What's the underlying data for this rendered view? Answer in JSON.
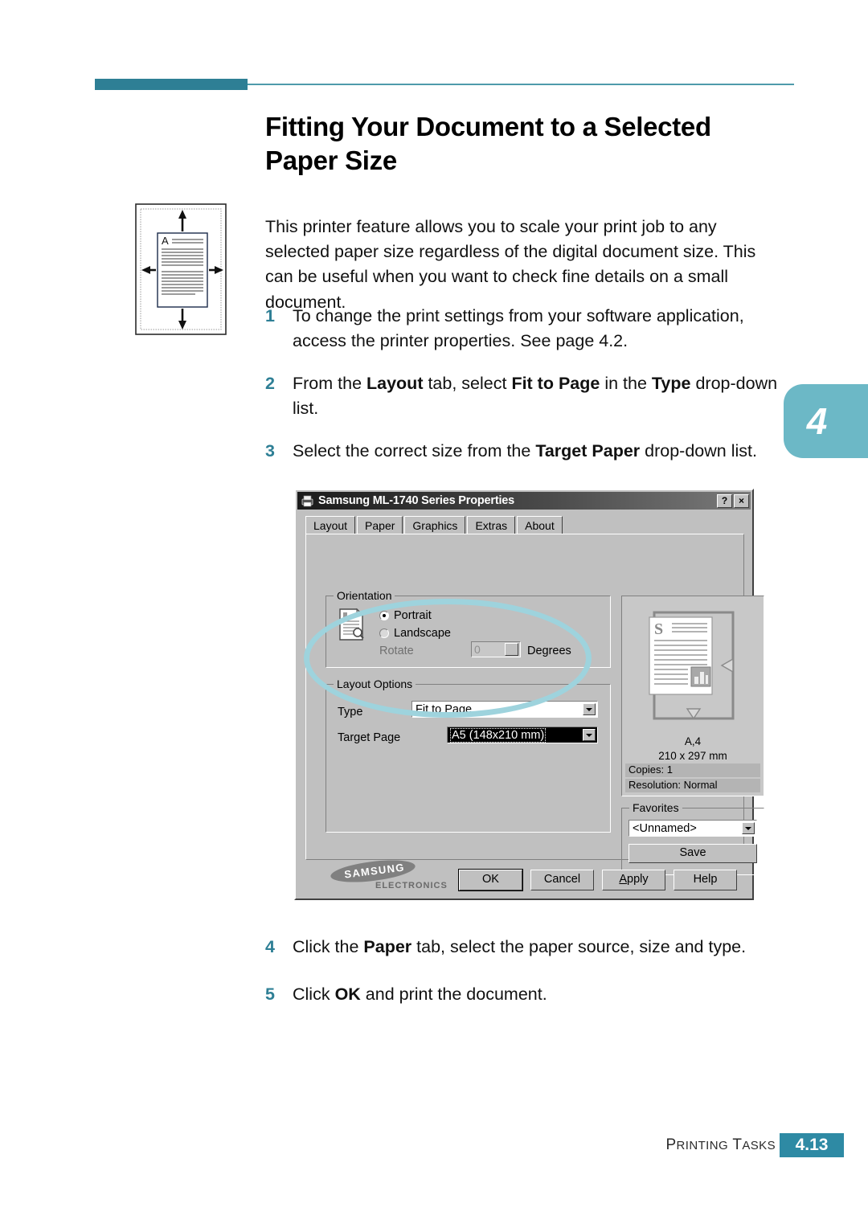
{
  "page": {
    "title_line1": "Fitting Your Document to a Selected",
    "title_line2": "Paper Size",
    "chapter_tab": "4",
    "accent_dark": "#2e7f95",
    "accent_light": "#6cb8c6",
    "highlight_color": "#9ed3dd"
  },
  "intro": {
    "text": "This printer feature allows you to scale your print job to any selected paper size regardless of the digital document size. This can be useful when you want to check fine details on a small document.",
    "illustration_letter": "A"
  },
  "steps": [
    {
      "num": "1",
      "html": "To change the print settings from your software application, access the printer properties. See page 4.2."
    },
    {
      "num": "2",
      "html": "From the <b>Layout</b> tab, select <b>Fit to Page</b> in the <b>Type</b> drop-down list."
    },
    {
      "num": "3",
      "html": "Select the correct size from the <b>Target Paper</b> drop-down list."
    },
    {
      "num": "4",
      "html": "Click the <b>Paper</b> tab, select the paper source, size and type."
    },
    {
      "num": "5",
      "html": "Click <b>OK</b> and print the document."
    }
  ],
  "dialog": {
    "title": "Samsung ML-1740 Series Properties",
    "titlebar_help": "?",
    "titlebar_close": "×",
    "tabs": [
      {
        "label": "Layout",
        "active": true
      },
      {
        "label": "Paper",
        "active": false
      },
      {
        "label": "Graphics",
        "active": false
      },
      {
        "label": "Extras",
        "active": false
      },
      {
        "label": "About",
        "active": false
      }
    ],
    "orientation": {
      "group_title": "Orientation",
      "portrait_label": "Portrait",
      "landscape_label": "Landscape",
      "portrait_selected": true,
      "rotate_label": "Rotate",
      "rotate_value": "0",
      "degrees_label": "Degrees"
    },
    "layout_options": {
      "group_title": "Layout Options",
      "type_label": "Type",
      "type_value": "Fit to Page",
      "target_label": "Target Page",
      "target_value": "A5 (148x210 mm)"
    },
    "preview": {
      "page_letter": "S",
      "paper_name": "A,4",
      "paper_dims": "210 x 297 mm",
      "copies": "Copies: 1",
      "resolution": "Resolution: Normal"
    },
    "favorites": {
      "group_title": "Favorites",
      "value": "<Unnamed>",
      "save_label": "Save"
    },
    "brand": {
      "name": "SAMSUNG",
      "sub": "ELECTRONICS"
    },
    "buttons": {
      "ok": "OK",
      "cancel": "Cancel",
      "apply_pre": "A",
      "apply_post": "pply",
      "help": "Help"
    }
  },
  "footer": {
    "section_p": "P",
    "section_rinting": "RINTING",
    "section_t": "T",
    "section_asks": "ASKS",
    "page_number": "4.13"
  }
}
